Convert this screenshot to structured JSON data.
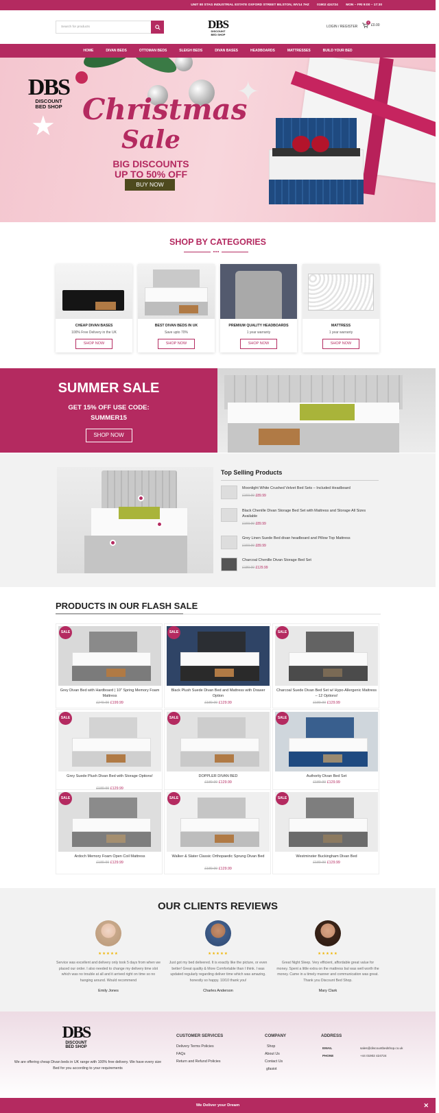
{
  "topbar": {
    "address": "UNIT 80 STAG INDUSTRIAL ESTATE OXFORD STREET BILSTON, WV14 7HZ",
    "phone": "01902 424724",
    "hours": "MON – FRI 9:00 – 17:30"
  },
  "header": {
    "search_placeholder": "Search for products",
    "logo_main": "DBS",
    "logo_line1": "DISCOUNT",
    "logo_line2": "BED SHOP",
    "login": "LOGIN / REGISTER",
    "cart_count": "0",
    "cart_total": "£0.00"
  },
  "nav": [
    "HOME",
    "DIVAN BEDS",
    "OTTOMAN BEDS",
    "SLEIGH BEDS",
    "DIVAN BASES",
    "HEADBOARDS",
    "MATTRESSES",
    "BUILD YOUR BED"
  ],
  "hero": {
    "logo_main": "DBS",
    "logo_line1": "DISCOUNT",
    "logo_line2": "BED SHOP",
    "title_line1": "Christmas",
    "title_line2": "Sale",
    "subtitle_line1": "BIG DISCOUNTS",
    "subtitle_line2": "UP TO 50% OFF",
    "button": "BUY NOW"
  },
  "categories": {
    "title": "SHOP BY CATEGORIES",
    "items": [
      {
        "name": "CHEAP DIVAN BASES",
        "sub": "100% Free Delivery in the UK",
        "button": "SHOP NOW"
      },
      {
        "name": "BEST DIVAN BEDS IN UK",
        "sub": "Save upto 70%",
        "button": "SHOP NOW"
      },
      {
        "name": "PREMIUM QUALITY HEADBOARDS",
        "sub": "1 year warranty",
        "button": "SHOP NOW"
      },
      {
        "name": "MATTRESS",
        "sub": "1 year warranty",
        "button": "SHOP NOW"
      }
    ]
  },
  "summer": {
    "title": "SUMMER SALE",
    "line1": "GET 15% OFF USE CODE:",
    "line2": "SUMMER15",
    "button": "SHOP NOW"
  },
  "top_selling": {
    "title": "Top Selling Products",
    "items": [
      {
        "name": "Moonlight White Crushed Velvet Bed Sets – Included Headboard",
        "old": "£169.99",
        "new": "£89.99"
      },
      {
        "name": "Black Chenille Divan Storage Bed Set with Mattress and Storage All Sizes Available",
        "old": "£169.99",
        "new": "£89.99"
      },
      {
        "name": "Grey Linen Suede Bed divan headboard and Pillow Top Mattress",
        "old": "£169.99",
        "new": "£89.99"
      },
      {
        "name": "Charcoal Chenille Divan Storage Bed Set",
        "old": "£189.99",
        "new": "£129.99"
      }
    ]
  },
  "flash": {
    "title": "PRODUCTS IN OUR FLASH SALE",
    "sale_label": "SALE",
    "products": [
      {
        "name": "Grey Divan Bed with Hardboard | 10\" Spring Memory Foam Mattress",
        "old": "£249.99",
        "new": "£199.99"
      },
      {
        "name": "Black Plush Suede Divan Bed and Mattress with Drawer Option",
        "old": "£189.99",
        "new": "£129.99"
      },
      {
        "name": "Charcoal Suede Divan Bed Set w/ Hypo-Allergenic Mattress – 12 Options!",
        "old": "£189.99",
        "new": "£129.99"
      },
      {
        "name": "Grey Suede Plush Divan Bed with Storage Options!",
        "old": "£189.99",
        "new": "£129.99"
      },
      {
        "name": "DOPPLER DIVAN BED",
        "old": "£189.99",
        "new": "£129.99"
      },
      {
        "name": "Authority Divan Bed Set",
        "old": "£189.99",
        "new": "£129.99"
      },
      {
        "name": "Ardoch Memory Foam Open Coil Mattress",
        "old": "£189.99",
        "new": "£129.99"
      },
      {
        "name": "Walker & Slater Classic Orthopaedic Sprung Divan Bed",
        "old": "£189.99",
        "new": "£129.99"
      },
      {
        "name": "Westminster Buckingham Divan Bed",
        "old": "£189.99",
        "new": "£129.99"
      }
    ]
  },
  "reviews": {
    "title": "OUR CLIENTS REVIEWS",
    "stars": "★★★★★",
    "items": [
      {
        "text": "Service was excellent and delivery only took 5 days from when we placed our order. I also needed to change my delivery time slot which was no trouble at all and it arrived right on time so no hanging around. Would recommend",
        "name": "Emily Jones"
      },
      {
        "text": "Just got my bed delivered. It is exactly like the picture, or even better! Great quality & More Comfortable than I think. I was updated regularly regarding deliver time which was amazing. honestly so happy. 10/10 thank you!",
        "name": "Charles Anderson"
      },
      {
        "text": "Great Night Sleep. Very efficient, affordable great value for money. Spent a little extra on the mattress but was well worth the money. Came in a timely manner and communication was great. Thank you Discount Bed Shop.",
        "name": "Mary Clark"
      }
    ]
  },
  "footer": {
    "logo_main": "DBS",
    "logo_line1": "DISCOUNT",
    "logo_line2": "BED SHOP",
    "description": "We are offering cheap Divan beds in UK range with 100% free delivery. We have every size Bed for you according to your requirements",
    "customer_services": {
      "title": "CUSTOMER SERVICES",
      "links": [
        "Delivery Terms Policies",
        "FAQs",
        "Return and Refund Policies"
      ]
    },
    "company": {
      "title": "COMPANY",
      "links": [
        "Shop",
        "About Us",
        "Contact Us",
        "gfasiot"
      ]
    },
    "address": {
      "title": "ADDRESS",
      "email_label": "EMAIL",
      "email": "sales@discountbedshop.co.uk",
      "phone_label": "PHONE",
      "phone": "+44 01902 424724"
    },
    "bottom_bar": "We Deliver your Dream",
    "close": "✕"
  },
  "colors": {
    "accent": "#b42a60",
    "button_dark": "#4e4a1e"
  }
}
